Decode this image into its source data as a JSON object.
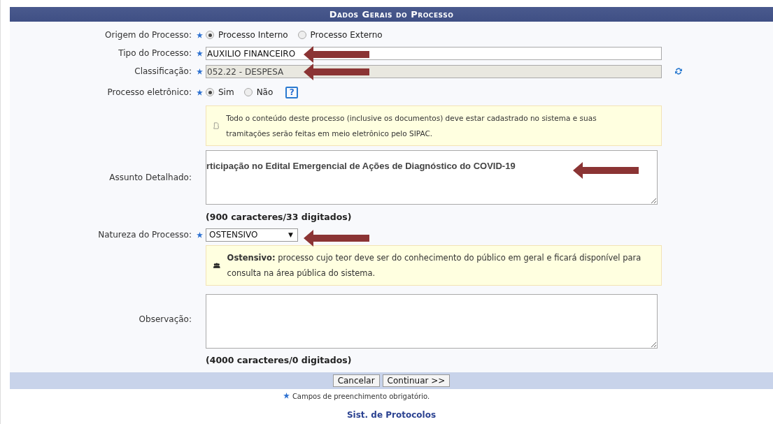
{
  "header": {
    "title": "Dados Gerais do Processo"
  },
  "origem": {
    "label": "Origem do Processo:",
    "required": true,
    "options": [
      {
        "label": "Processo Interno",
        "selected": true
      },
      {
        "label": "Processo Externo",
        "selected": false
      }
    ]
  },
  "tipo": {
    "label": "Tipo do Processo:",
    "required": true,
    "value": "AUXILIO FINANCEIRO"
  },
  "classificacao": {
    "label": "Classificação:",
    "required": true,
    "value": "052.22 - DESPESA"
  },
  "eletronico": {
    "label": "Processo eletrônico:",
    "required": true,
    "options": [
      {
        "label": "Sim",
        "selected": true
      },
      {
        "label": "Não",
        "selected": false
      }
    ],
    "help": "?",
    "notice": "Todo o conteúdo deste processo (inclusive os documentos) deve estar cadastrado no sistema e suas tramitações serão feitas em meio eletrônico pelo SIPAC."
  },
  "assunto": {
    "label": "Assunto Detalhado:",
    "value": "rticipação no Edital Emergencial de Ações de Diagnóstico do COVID-19",
    "counter": "(900 caracteres/33 digitados)"
  },
  "natureza": {
    "label": "Natureza do Processo:",
    "required": true,
    "value": "OSTENSIVO",
    "caret": "▼",
    "notice": "**Ostensivo:** processo cujo teor deve ser do conhecimento do público em geral e ficará disponível para consulta na área pública do sistema."
  },
  "observacao": {
    "label": "Observação:",
    "counter": "(4000 caracteres/0 digitados)"
  },
  "buttons": [
    "Cancelar",
    "Continuar >>"
  ],
  "required_note": "Campos de preenchimento obrigatório.",
  "footer_link": "Sist. de Protocolos"
}
